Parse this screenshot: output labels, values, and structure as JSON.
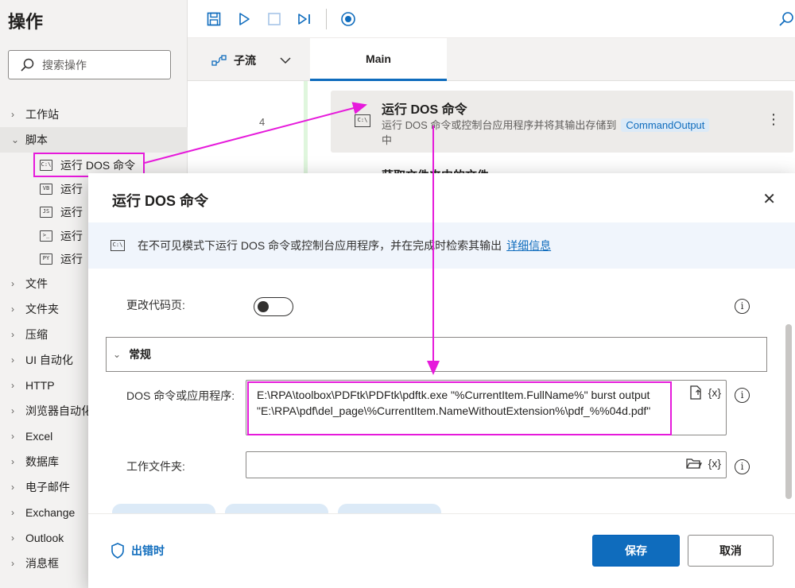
{
  "left_panel": {
    "title": "操作",
    "search_placeholder": "搜索操作",
    "tree": [
      {
        "label": "工作站",
        "expanded": false
      },
      {
        "label": "脚本",
        "expanded": true
      },
      {
        "label": "文件",
        "expanded": false
      },
      {
        "label": "文件夹",
        "expanded": false
      },
      {
        "label": "压缩",
        "expanded": false
      },
      {
        "label": "UI 自动化",
        "expanded": false
      },
      {
        "label": "HTTP",
        "expanded": false
      },
      {
        "label": "浏览器自动化",
        "expanded": false
      },
      {
        "label": "Excel",
        "expanded": false
      },
      {
        "label": "数据库",
        "expanded": false
      },
      {
        "label": "电子邮件",
        "expanded": false
      },
      {
        "label": "Exchange",
        "expanded": false
      },
      {
        "label": "Outlook",
        "expanded": false
      },
      {
        "label": "消息框",
        "expanded": false
      }
    ],
    "script_actions": [
      {
        "label": "运行 DOS 命令",
        "icon": "C:\\"
      },
      {
        "label": "运行",
        "icon": "VB"
      },
      {
        "label": "运行",
        "icon": "JS"
      },
      {
        "label": "运行",
        "icon": ">_"
      },
      {
        "label": "运行",
        "icon": "PY"
      }
    ]
  },
  "toolbar": {
    "icons": [
      "save-icon",
      "run-icon",
      "stop-icon",
      "step-icon",
      "record-icon",
      "search-icon"
    ]
  },
  "tabs": {
    "subflow_label": "子流",
    "main_label": "Main"
  },
  "flow": {
    "line_number": "4",
    "step_title": "运行 DOS 命令",
    "step_desc": "运行 DOS 命令或控制台应用程序并将其输出存储到",
    "step_var": "CommandOutput",
    "step_desc_tail": "中",
    "next_step_title": "获取文件夹中的文件"
  },
  "dialog": {
    "title": "运行 DOS 命令",
    "info_text": "在不可见模式下运行 DOS 命令或控制台应用程序，并在完成时检索其输出",
    "info_link": "详细信息",
    "change_codepage_label": "更改代码页:",
    "change_codepage_on": false,
    "section_label": "常规",
    "cmd_label": "DOS 命令或应用程序:",
    "cmd_value": "E:\\RPA\\toolbox\\PDFtk\\PDFtk\\pdftk.exe \"%CurrentItem.FullName%\" burst output \"E:\\RPA\\pdf\\del_page\\%CurrentItem.NameWithoutExtension%\\pdf_%%04d.pdf\"",
    "var_button": "{x}",
    "workdir_label": "工作文件夹:",
    "workdir_value": "",
    "on_error_label": "出错时",
    "save_label": "保存",
    "cancel_label": "取消"
  },
  "colors": {
    "accent": "#0f6cbd",
    "annotation": "#e61adb"
  }
}
